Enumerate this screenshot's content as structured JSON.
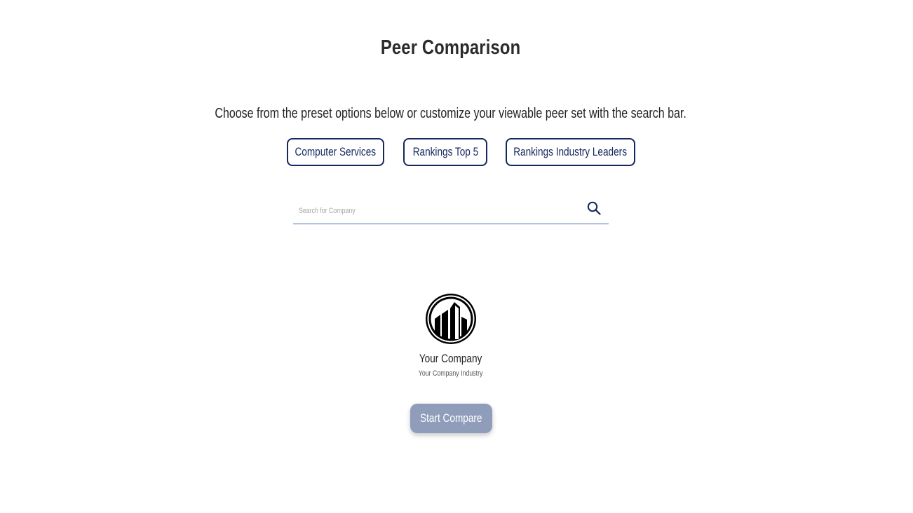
{
  "header": {
    "title": "Peer Comparison",
    "subtitle": "Choose from the preset options below or customize your viewable peer set with the search bar."
  },
  "presets": [
    {
      "label": "Computer Services"
    },
    {
      "label": "Rankings Top 5"
    },
    {
      "label": "Rankings Industry Leaders"
    }
  ],
  "search": {
    "placeholder": "Search for Company",
    "value": "",
    "icon": "search-icon"
  },
  "company": {
    "icon": "building-logo-icon",
    "name": "Your Company",
    "industry": "Your Company Industry"
  },
  "actions": {
    "start_compare": "Start Compare"
  },
  "colors": {
    "accent": "#14275e",
    "underline": "#4a6db5",
    "start_button": "#8f9dbb"
  }
}
